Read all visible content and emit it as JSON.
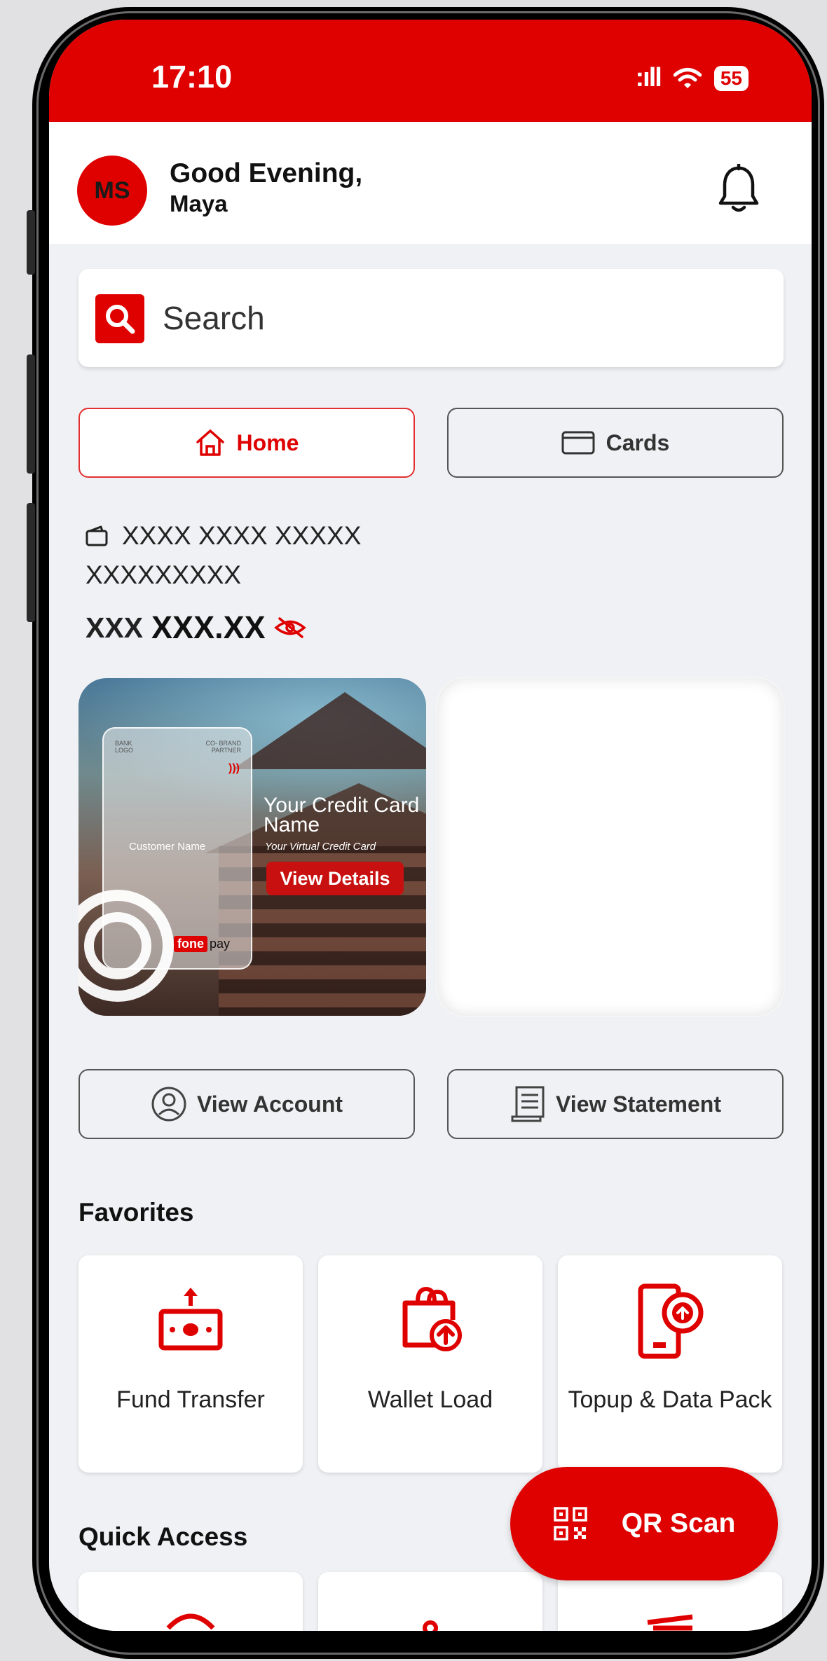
{
  "status_bar": {
    "time": "17:10",
    "signal": ":ıll",
    "battery": "55"
  },
  "header": {
    "avatar_initials": "MS",
    "greeting": "Good Evening,",
    "user_name": "Maya"
  },
  "search": {
    "placeholder": "Search"
  },
  "tabs": [
    {
      "label": "Home",
      "active": true
    },
    {
      "label": "Cards",
      "active": false
    }
  ],
  "account": {
    "number_line1": "XXXX XXXX XXXXX",
    "number_line2": "XXXXXXXXX",
    "currency": "XXX",
    "balance": "XXX.XX"
  },
  "promo_card": {
    "bank_logo": "BANK LOGO",
    "cobrand": "CO- BRAND PARTNER",
    "customer_name": "Customer Name",
    "card_title": "Your Credit Card Name",
    "card_subtitle": "Your Virtual Credit Card",
    "view_details": "View Details",
    "brand_fone": "fone",
    "brand_pay": "pay"
  },
  "actions": {
    "view_account": "View Account",
    "view_statement": "View Statement"
  },
  "favorites": {
    "title": "Favorites",
    "items": [
      {
        "label": "Fund Transfer",
        "icon": "fund-transfer-icon"
      },
      {
        "label": "Wallet Load",
        "icon": "wallet-load-icon"
      },
      {
        "label": "Topup &  Data Pack",
        "icon": "topup-icon"
      }
    ]
  },
  "quick_access": {
    "title": "Quick Access"
  },
  "qr_scan": {
    "label": "QR Scan"
  },
  "colors": {
    "brand_red": "#df0000",
    "background": "#f0f1f4"
  }
}
